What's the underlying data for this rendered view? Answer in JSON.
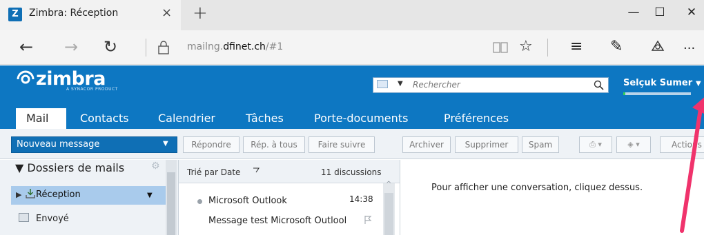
{
  "browser": {
    "tab_title": "Zimbra: Réception",
    "tab_favicon": "Z",
    "close_tab_glyph": "×",
    "new_tab_glyph": "+",
    "window_controls": {
      "minimize": "—",
      "maximize": "☐",
      "close": "✕"
    },
    "nav": {
      "back": "←",
      "forward": "→",
      "refresh": "↻",
      "lock": "🔒"
    },
    "url_prefix": "mailng.",
    "url_domain": "dfinet.ch",
    "url_suffix": "/#1",
    "tools": {
      "reading_view": "📖",
      "favorite": "☆",
      "hub": "≡",
      "notes": "✎",
      "share": "⇧",
      "more": "···"
    }
  },
  "zimbra": {
    "logo_text": "zimbra",
    "logo_sub": "A SYNACOR PRODUCT",
    "search_placeholder": "Rechercher",
    "user_name": "Selçuk Sumer",
    "quota_fraction": 0.03,
    "tabs": [
      "Contacts",
      "Calendrier",
      "Tâches",
      "Porte-documents",
      "Préférences"
    ],
    "active_tab": "Mail"
  },
  "toolbar": {
    "new_message": "Nouveau message",
    "buttons": [
      "Répondre",
      "Rép. à tous",
      "Faire suivre",
      "Archiver",
      "Supprimer",
      "Spam"
    ],
    "actions": "Actions"
  },
  "folders": {
    "title": "Dossiers de mails",
    "items": [
      {
        "label": "Réception",
        "selected": true
      },
      {
        "label": "Envoyé",
        "selected": false
      }
    ]
  },
  "list": {
    "sort_label": "Trié par Date",
    "count_label": "11 discussions",
    "messages": [
      {
        "sender": "Microsoft Outlook",
        "time": "14:38",
        "subject": "Message test Microsoft Outlool"
      }
    ]
  },
  "reading": {
    "empty_message": "Pour afficher une conversation, cliquez dessus."
  },
  "colors": {
    "zimbra_blue": "#0d77c2",
    "selected_row": "#a9cbec",
    "annotation_arrow": "#f0336c"
  }
}
